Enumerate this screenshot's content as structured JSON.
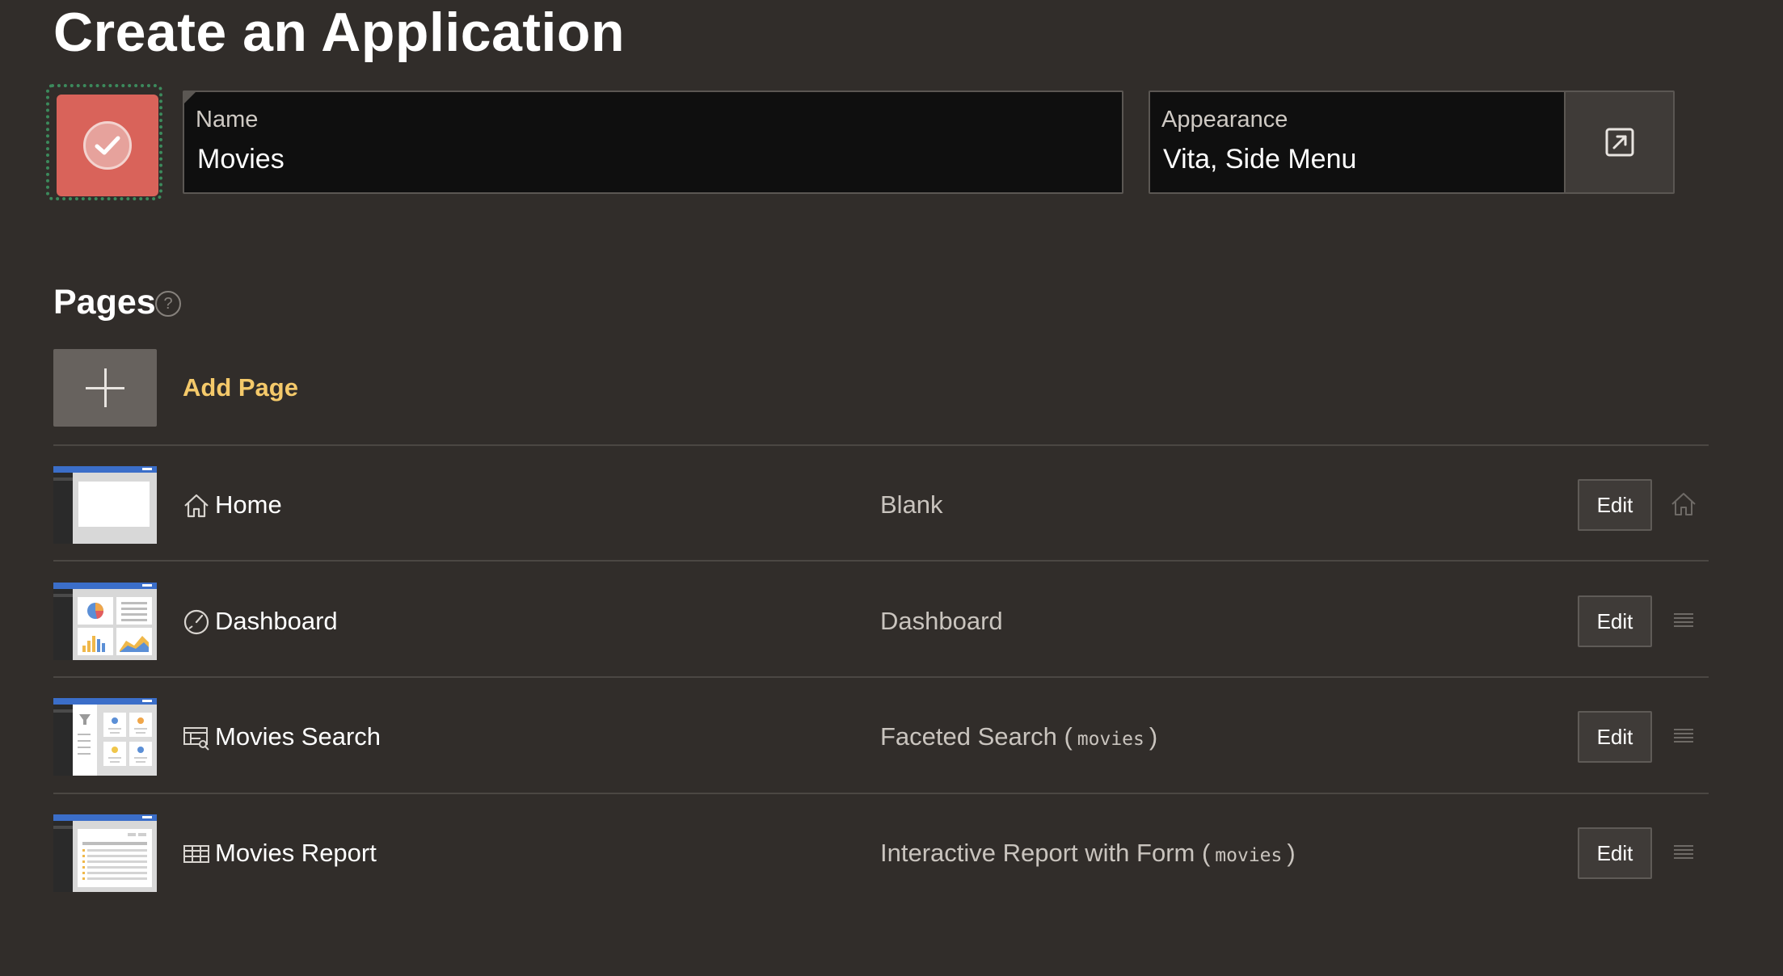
{
  "title": "Create an Application",
  "app_icon": {
    "color": "#d9635a",
    "icon": "check-circle-icon"
  },
  "name_field": {
    "label": "Name",
    "value": "Movies"
  },
  "appearance_field": {
    "label": "Appearance",
    "value": "Vita, Side Menu",
    "button_icon": "open-external-icon"
  },
  "pages_section": {
    "heading": "Pages",
    "help_glyph": "?",
    "add_page_label": "Add Page"
  },
  "pages": [
    {
      "name": "Home",
      "icon": "home-icon",
      "type": "Blank",
      "table": "",
      "edit_label": "Edit",
      "trail_icon": "home-icon"
    },
    {
      "name": "Dashboard",
      "icon": "gauge-icon",
      "type": "Dashboard",
      "table": "",
      "edit_label": "Edit",
      "trail_icon": "drag-handle-icon"
    },
    {
      "name": "Movies Search",
      "icon": "faceted-search-icon",
      "type": "Faceted Search",
      "table": "movies",
      "edit_label": "Edit",
      "trail_icon": "drag-handle-icon"
    },
    {
      "name": "Movies Report",
      "icon": "report-icon",
      "type": "Interactive Report with Form",
      "table": "movies",
      "edit_label": "Edit",
      "trail_icon": "drag-handle-icon"
    }
  ],
  "colors": {
    "background": "#312d2a",
    "accent_link": "#f4c96a",
    "thumb_header": "#3b6ec9"
  }
}
